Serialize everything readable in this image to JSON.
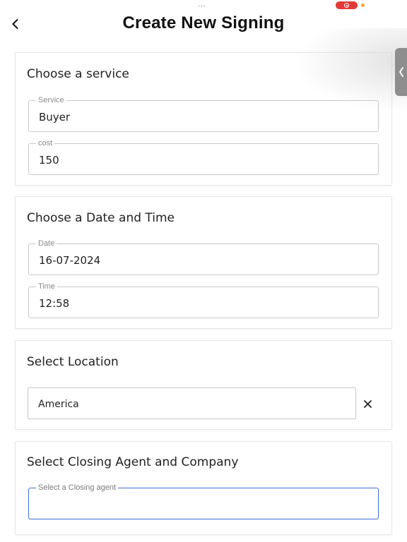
{
  "status": {
    "dots": "•••"
  },
  "header": {
    "title": "Create New Signing"
  },
  "service_section": {
    "title": "Choose a service",
    "service": {
      "label": "Service",
      "value": "Buyer"
    },
    "cost": {
      "label": "cost",
      "value": "150"
    }
  },
  "datetime_section": {
    "title": "Choose a Date and Time",
    "date": {
      "label": "Date",
      "value": "16-07-2024"
    },
    "time": {
      "label": "Time",
      "value": "12:58"
    }
  },
  "location_section": {
    "title": "Select Location",
    "location": {
      "value": "America"
    }
  },
  "agent_section": {
    "title": "Select Closing Agent and Company",
    "agent": {
      "label": "Select a Closing agent",
      "value": ""
    }
  },
  "colors": {
    "accent": "#3b6fd8",
    "recording": "#e23a36",
    "indicator": "#f5a623"
  }
}
